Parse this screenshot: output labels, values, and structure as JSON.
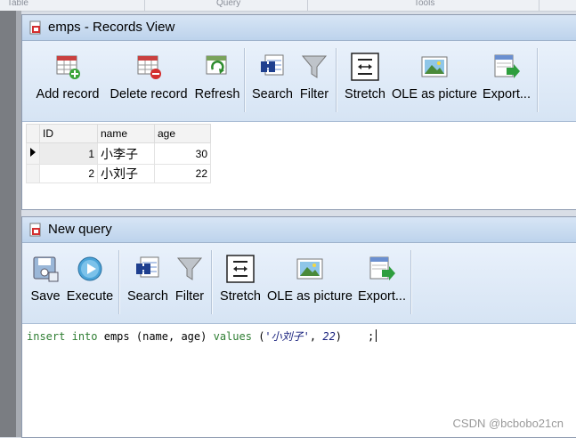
{
  "ribbon_groups": [
    "Table",
    "Query",
    "Tools"
  ],
  "records_window": {
    "title": "emps - Records View",
    "toolbar": [
      {
        "label": "Add record",
        "icon": "add-record-icon"
      },
      {
        "label": "Delete record",
        "icon": "delete-record-icon"
      },
      {
        "label": "Refresh",
        "icon": "refresh-icon"
      },
      {
        "label": "Search",
        "icon": "search-icon"
      },
      {
        "label": "Filter",
        "icon": "filter-icon"
      },
      {
        "label": "Stretch",
        "icon": "stretch-icon"
      },
      {
        "label": "OLE as picture",
        "icon": "ole-picture-icon"
      },
      {
        "label": "Export...",
        "icon": "export-icon"
      }
    ],
    "grid": {
      "columns": [
        "ID",
        "name",
        "age"
      ],
      "rows": [
        [
          "1",
          "小李子",
          "30"
        ],
        [
          "2",
          "小刘子",
          "22"
        ]
      ]
    }
  },
  "query_window": {
    "title": "New query",
    "toolbar": [
      {
        "label": "Save",
        "icon": "save-icon"
      },
      {
        "label": "Execute",
        "icon": "execute-icon"
      },
      {
        "label": "Search",
        "icon": "search-icon"
      },
      {
        "label": "Filter",
        "icon": "filter-icon"
      },
      {
        "label": "Stretch",
        "icon": "stretch-icon"
      },
      {
        "label": "OLE as picture",
        "icon": "ole-picture-icon"
      },
      {
        "label": "Export...",
        "icon": "export-icon"
      }
    ],
    "sql": {
      "kw_insert": "insert",
      "kw_into": "into",
      "table": "emps",
      "cols": "(name, age)",
      "kw_values": "values",
      "open": "(",
      "str_val": "'小刘子'",
      "comma": ",",
      "num_val": "22",
      "close": ")",
      "semicolon": ";"
    }
  },
  "watermark": "CSDN @bcbobo21cn"
}
